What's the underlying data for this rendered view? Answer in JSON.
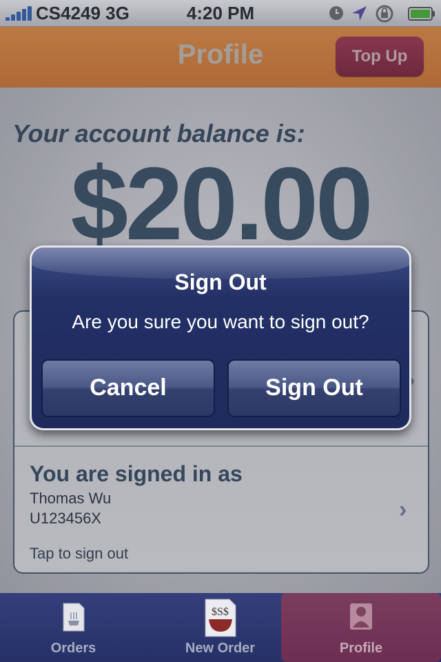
{
  "status_bar": {
    "carrier": "CS4249 3G",
    "time": "4:20 PM"
  },
  "nav": {
    "title": "Profile",
    "top_up_label": "Top Up"
  },
  "balance": {
    "label": "Your account balance is:",
    "amount": "$20.00"
  },
  "signed_in": {
    "title": "You are signed in as",
    "name": "Thomas Wu",
    "id": "U123456X",
    "hint": "Tap to sign out"
  },
  "alert": {
    "title": "Sign Out",
    "message": "Are you sure you want to sign out?",
    "cancel_label": "Cancel",
    "confirm_label": "Sign Out"
  },
  "tabs": [
    {
      "label": "Orders",
      "icon": "orders-icon"
    },
    {
      "label": "New Order",
      "icon": "new-order-icon"
    },
    {
      "label": "Profile",
      "icon": "profile-icon",
      "active": true
    }
  ],
  "colors": {
    "nav_orange": "#d98a47",
    "top_up": "#8e344c",
    "alert_blue": "#233066",
    "tab_active": "#7a3d5e"
  }
}
